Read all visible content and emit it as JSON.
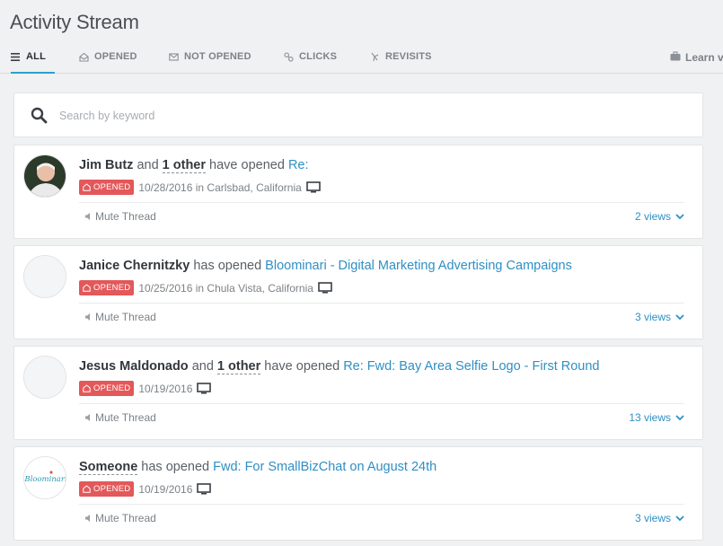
{
  "page_title": "Activity Stream",
  "tabs": [
    {
      "label": "ALL",
      "icon": "list-icon",
      "active": true
    },
    {
      "label": "OPENED",
      "icon": "open-envelope-icon"
    },
    {
      "label": "NOT OPENED",
      "icon": "envelope-icon"
    },
    {
      "label": "CLICKS",
      "icon": "link-icon"
    },
    {
      "label": "REVISITS",
      "icon": "revisit-icon"
    }
  ],
  "learn_label": "Learn v",
  "search": {
    "placeholder": "Search by keyword",
    "value": ""
  },
  "colors": {
    "accent": "#2aa0cf",
    "link": "#2f8fc4",
    "badge": "#e3585a",
    "background": "#f0f1f2"
  },
  "activities": [
    {
      "name": "Jim Butz",
      "conj": " and ",
      "other": "1 other",
      "verb": " have opened ",
      "subject": "Re:",
      "badge": "OPENED",
      "date": "10/28/2016",
      "location": " in Carlsbad, California",
      "mute": "Mute Thread",
      "views": "2 views",
      "avatar": "photo"
    },
    {
      "name": "Janice Chernitzky",
      "conj": "",
      "other": "",
      "verb": " has opened ",
      "subject": "Bloominari - Digital Marketing Advertising Campaigns",
      "badge": "OPENED",
      "date": "10/25/2016",
      "location": " in Chula Vista, California",
      "mute": "Mute Thread",
      "views": "3 views",
      "avatar": "placeholder"
    },
    {
      "name": "Jesus Maldonado",
      "conj": " and ",
      "other": "1 other",
      "verb": " have opened ",
      "subject": "Re: Fwd: Bay Area Selfie Logo - First Round",
      "badge": "OPENED",
      "date": "10/19/2016",
      "location": "",
      "mute": "Mute Thread",
      "views": "13 views",
      "avatar": "placeholder"
    },
    {
      "name": "Someone",
      "conj": "",
      "other": "",
      "verb": " has opened ",
      "subject": "Fwd: For SmallBizChat on August 24th",
      "badge": "OPENED",
      "date": "10/19/2016",
      "location": "",
      "mute": "Mute Thread",
      "views": "3 views",
      "avatar": "logo",
      "logo_text": "Bloominari"
    }
  ]
}
